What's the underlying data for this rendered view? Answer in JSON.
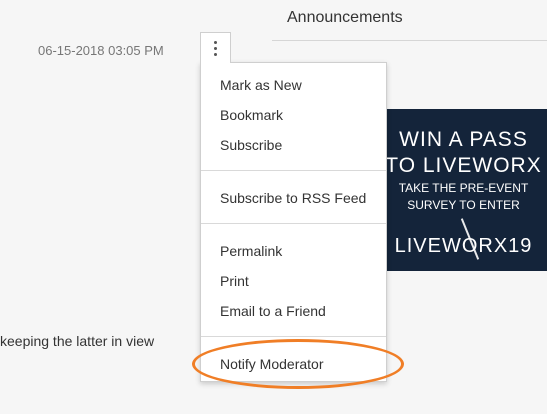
{
  "page": {
    "section_title": "Announcements",
    "timestamp": "06-15-2018 03:05 PM",
    "body_text_fragment": "keeping the latter in view"
  },
  "options_menu": {
    "trigger_icon": "kebab-vertical-icon",
    "groups": [
      [
        "Mark as New",
        "Bookmark",
        "Subscribe"
      ],
      [
        "Subscribe to RSS Feed"
      ],
      [
        "Permalink",
        "Print",
        "Email to a Friend"
      ],
      [
        "Notify Moderator"
      ]
    ]
  },
  "banner": {
    "headline_line1": "WIN A PASS",
    "headline_line2": "TO LIVEWORX",
    "sub_line1": "TAKE THE PRE-EVENT",
    "sub_line2": "SURVEY TO ENTER",
    "logo": "LIVEWORX19",
    "background_color": "#14243a"
  },
  "annotation": {
    "highlight_color": "#f07e26"
  }
}
